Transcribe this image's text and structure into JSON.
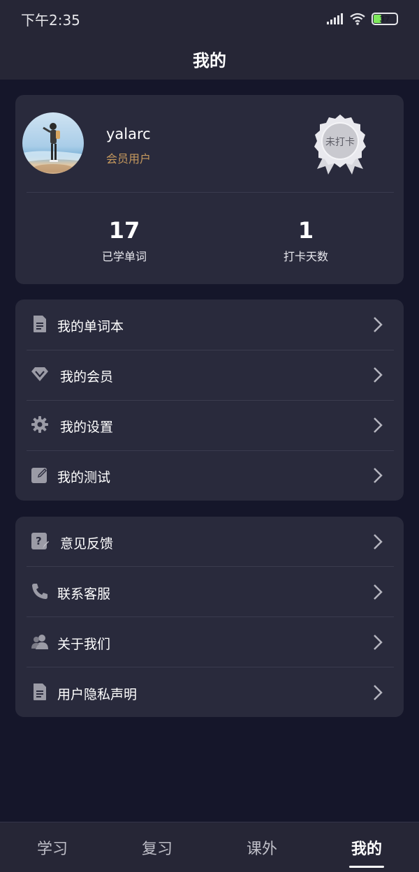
{
  "status_bar": {
    "time": "下午2:35",
    "battery": "37",
    "battery_level_percent": 37
  },
  "header": {
    "title": "我的"
  },
  "profile": {
    "username": "yalarc",
    "role": "会员用户",
    "checkin_badge": "未打卡",
    "stats": [
      {
        "value": "17",
        "label": "已学单词"
      },
      {
        "value": "1",
        "label": "打卡天数"
      }
    ]
  },
  "menu_group_1": [
    {
      "label": "我的单词本",
      "icon": "document-icon"
    },
    {
      "label": "我的会员",
      "icon": "diamond-icon"
    },
    {
      "label": "我的设置",
      "icon": "gear-icon"
    },
    {
      "label": "我的测试",
      "icon": "edit-icon"
    }
  ],
  "menu_group_2": [
    {
      "label": "意见反馈",
      "icon": "feedback-icon"
    },
    {
      "label": "联系客服",
      "icon": "phone-icon"
    },
    {
      "label": "关于我们",
      "icon": "users-icon"
    },
    {
      "label": "用户隐私声明",
      "icon": "document-icon"
    }
  ],
  "tab_bar": {
    "tabs": [
      {
        "label": "学习"
      },
      {
        "label": "复习"
      },
      {
        "label": "课外"
      },
      {
        "label": "我的"
      }
    ],
    "active": "我的"
  },
  "colors": {
    "background": "#15162a",
    "card": "#292a3c",
    "bar": "#262636",
    "member_gold": "#c79a5e",
    "battery_green": "#7ee85c"
  }
}
